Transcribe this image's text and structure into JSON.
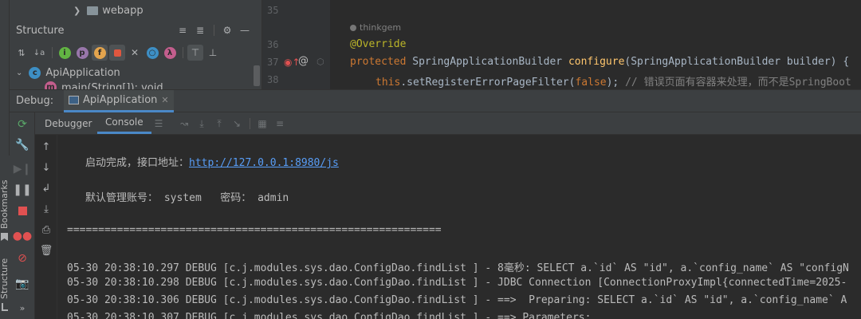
{
  "project_tree": {
    "webapp_label": "webapp"
  },
  "structure": {
    "title": "Structure",
    "root_class": "ApiApplication",
    "child_method": "main(String[]): void"
  },
  "editor": {
    "line_numbers": [
      "35",
      "36",
      "37",
      "38"
    ],
    "author_hint": "thinkgem",
    "annotation": "@Override",
    "line37": {
      "kw": "protected",
      "type": "SpringApplicationBuilder",
      "method": "configure",
      "params": "(SpringApplicationBuilder builder) {"
    },
    "line38": {
      "this_kw": "this",
      "call": ".setRegisterErrorPageFilter(",
      "false_kw": "false",
      "close": ");",
      "comment": "// 错误页面有容器来处理，而不是SpringBoot"
    }
  },
  "debug": {
    "label": "Debug:",
    "tab_name": "ApiApplication",
    "tabs": {
      "debugger": "Debugger",
      "console": "Console"
    }
  },
  "console": {
    "started_label": "启动完成，接口地址：",
    "started_url": "http://127.0.0.1:8980/js",
    "admin_line": "默认管理账号： system   密码： admin",
    "separator": "============================================================",
    "logs": [
      "05-30 20:38:10.297 DEBUG [c.j.modules.sys.dao.ConfigDao.findList ] - 8毫秒: SELECT a.`id` AS \"id\", a.`config_name` AS \"configN",
      "05-30 20:38:10.298 DEBUG [c.j.modules.sys.dao.ConfigDao.findList ] - JDBC Connection [ConnectionProxyImpl{connectedTime=2025-",
      "05-30 20:38:10.306 DEBUG [c.j.modules.sys.dao.ConfigDao.findList ] - ==>  Preparing: SELECT a.`id` AS \"id\", a.`config_name` A",
      "05-30 20:38:10.307 DEBUG [c.j.modules.sys.dao.ConfigDao.findList ] - ==> Parameters:"
    ]
  },
  "side_tabs": {
    "bookmarks": "Bookmarks",
    "structure": "Structure"
  },
  "colors": {
    "keyword": "#cc7832",
    "annotation": "#bbb529",
    "method": "#ffc66d",
    "comment": "#808080",
    "link": "#589df6",
    "class_icon": "#3d8fc5"
  }
}
